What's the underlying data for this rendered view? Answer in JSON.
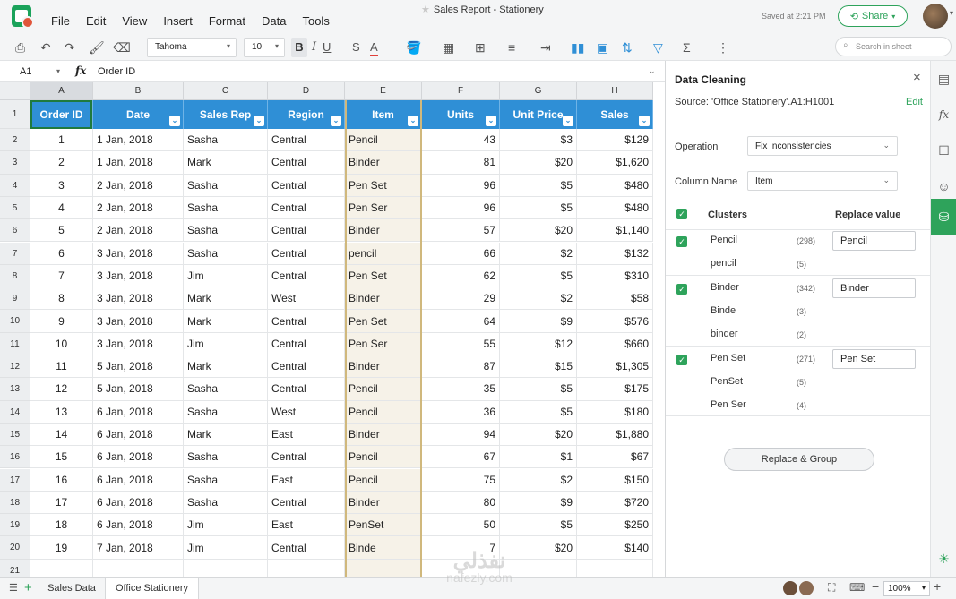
{
  "menubar": {
    "items": [
      "File",
      "Edit",
      "View",
      "Insert",
      "Format",
      "Data",
      "Tools"
    ],
    "doc_title": "Sales Report - Stationery",
    "saved_status": "Saved at 2:21 PM",
    "share_label": "Share"
  },
  "toolbar": {
    "font": "Tahoma",
    "font_size": "10",
    "bold": "B",
    "italic": "I",
    "underline": "U",
    "strike": "S",
    "font_color": "A",
    "search_placeholder": "Search in sheet"
  },
  "formula_bar": {
    "cell_ref": "A1",
    "fx": "fx",
    "value": "Order ID"
  },
  "grid": {
    "columns": [
      "A",
      "B",
      "C",
      "D",
      "E",
      "F",
      "G",
      "H"
    ],
    "headers": [
      "Order ID",
      "Date",
      "Sales Rep",
      "Region",
      "Item",
      "Units",
      "Unit Price",
      "Sales"
    ],
    "rows": [
      [
        "1",
        "1 Jan, 2018",
        "Sasha",
        "Central",
        "Pencil",
        "43",
        "$3",
        "$129"
      ],
      [
        "2",
        "1 Jan, 2018",
        "Mark",
        "Central",
        "Binder",
        "81",
        "$20",
        "$1,620"
      ],
      [
        "3",
        "2 Jan, 2018",
        "Sasha",
        "Central",
        "Pen Set",
        "96",
        "$5",
        "$480"
      ],
      [
        "4",
        "2 Jan, 2018",
        "Sasha",
        "Central",
        "Pen Ser",
        "96",
        "$5",
        "$480"
      ],
      [
        "5",
        "2 Jan, 2018",
        "Sasha",
        "Central",
        "Binder",
        "57",
        "$20",
        "$1,140"
      ],
      [
        "6",
        "3 Jan, 2018",
        "Sasha",
        "Central",
        "pencil",
        "66",
        "$2",
        "$132"
      ],
      [
        "7",
        "3 Jan, 2018",
        "Jim",
        "Central",
        "Pen Set",
        "62",
        "$5",
        "$310"
      ],
      [
        "8",
        "3 Jan, 2018",
        "Mark",
        "West",
        "Binder",
        "29",
        "$2",
        "$58"
      ],
      [
        "9",
        "3 Jan, 2018",
        "Mark",
        "Central",
        "Pen Set",
        "64",
        "$9",
        "$576"
      ],
      [
        "10",
        "3 Jan, 2018",
        "Jim",
        "Central",
        "Pen Ser",
        "55",
        "$12",
        "$660"
      ],
      [
        "11",
        "5 Jan, 2018",
        "Mark",
        "Central",
        "Binder",
        "87",
        "$15",
        "$1,305"
      ],
      [
        "12",
        "5 Jan, 2018",
        "Sasha",
        "Central",
        "Pencil",
        "35",
        "$5",
        "$175"
      ],
      [
        "13",
        "6 Jan, 2018",
        "Sasha",
        "West",
        "Pencil",
        "36",
        "$5",
        "$180"
      ],
      [
        "14",
        "6 Jan, 2018",
        "Mark",
        "East",
        "Binder",
        "94",
        "$20",
        "$1,880"
      ],
      [
        "15",
        "6 Jan, 2018",
        "Sasha",
        "Central",
        "Pencil",
        "67",
        "$1",
        "$67"
      ],
      [
        "16",
        "6 Jan, 2018",
        "Sasha",
        "East",
        "Pencil",
        "75",
        "$2",
        "$150"
      ],
      [
        "17",
        "6 Jan, 2018",
        "Sasha",
        "Central",
        "Binder",
        "80",
        "$9",
        "$720"
      ],
      [
        "18",
        "6 Jan, 2018",
        "Jim",
        "East",
        "PenSet",
        "50",
        "$5",
        "$250"
      ],
      [
        "19",
        "7 Jan, 2018",
        "Jim",
        "Central",
        "Binde",
        "7",
        "$20",
        "$140"
      ]
    ]
  },
  "pane": {
    "title": "Data Cleaning",
    "source": "Source:  'Office Stationery'.A1:H1001",
    "edit": "Edit",
    "operation_label": "Operation",
    "operation_value": "Fix Inconsistencies",
    "column_label": "Column Name",
    "column_value": "Item",
    "clusters_header": "Clusters",
    "replace_header": "Replace value",
    "clusters": [
      {
        "items": [
          {
            "name": "Pencil",
            "count": "(298)"
          },
          {
            "name": "pencil",
            "count": "(5)"
          }
        ],
        "replace": "Pencil"
      },
      {
        "items": [
          {
            "name": "Binder",
            "count": "(342)"
          },
          {
            "name": "Binde",
            "count": "(3)"
          },
          {
            "name": "binder",
            "count": "(2)"
          }
        ],
        "replace": "Binder"
      },
      {
        "items": [
          {
            "name": "Pen Set",
            "count": "(271)"
          },
          {
            "name": "PenSet",
            "count": "(5)"
          },
          {
            "name": "Pen Ser",
            "count": "(4)"
          }
        ],
        "replace": "Pen Set"
      }
    ],
    "replace_button": "Replace & Group"
  },
  "bottom": {
    "sheets": [
      "Sales Data",
      "Office Stationery"
    ],
    "zoom": "100%"
  },
  "watermark": {
    "arabic": "نفذلي",
    "latin": "nafezly.com"
  },
  "colors": {
    "header_blue": "#2f8fd6",
    "accent_green": "#2ea35b"
  }
}
